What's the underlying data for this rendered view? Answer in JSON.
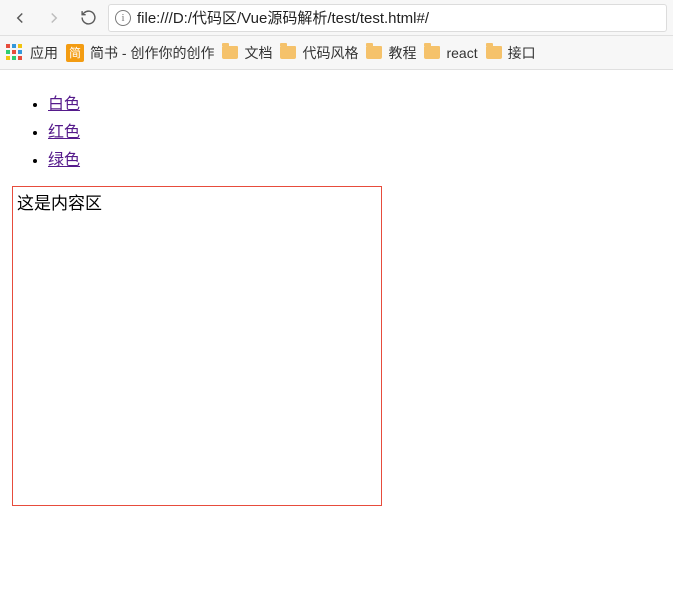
{
  "toolbar": {
    "url": "file:///D:/代码区/Vue源码解析/test/test.html#/"
  },
  "bookmarks": {
    "apps_label": "应用",
    "jianshu_label": "简书 - 创作你的创作",
    "folders": [
      "文档",
      "代码风格",
      "教程",
      "react",
      "接口"
    ]
  },
  "page": {
    "links": [
      "白色",
      "红色",
      "绿色"
    ],
    "content": "这是内容区"
  }
}
